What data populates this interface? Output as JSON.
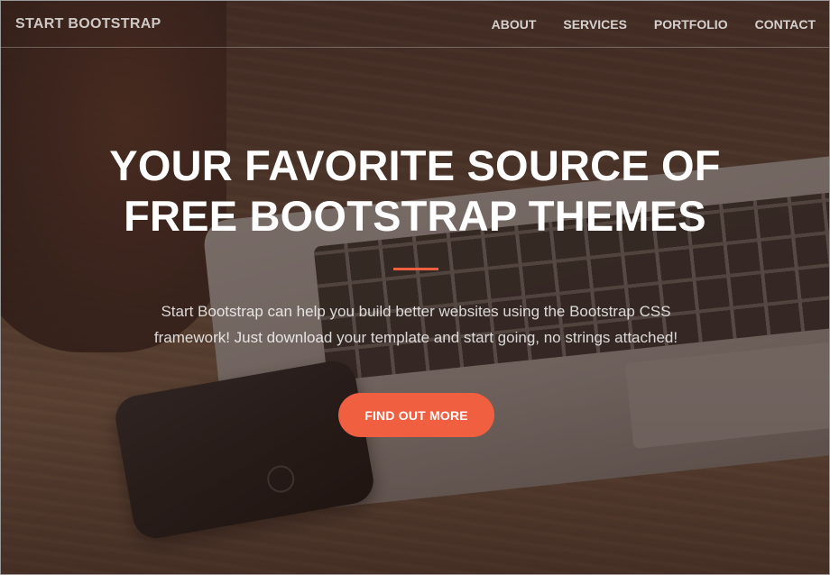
{
  "navbar": {
    "brand": "START BOOTSTRAP",
    "links": [
      "ABOUT",
      "SERVICES",
      "PORTFOLIO",
      "CONTACT"
    ]
  },
  "hero": {
    "headline_lines": [
      "YOUR FAVORITE SOURCE OF",
      "FREE BOOTSTRAP THEMES"
    ],
    "lead_lines": [
      "Start Bootstrap can help you build better websites using the Bootstrap CSS",
      "framework! Just download your template and start going, no strings attached!"
    ],
    "cta_label": "FIND OUT MORE"
  },
  "colors": {
    "accent": "#f05f40",
    "overlay": "#32201b"
  },
  "background_image": "desk-with-laptop-phone-and-coffee"
}
